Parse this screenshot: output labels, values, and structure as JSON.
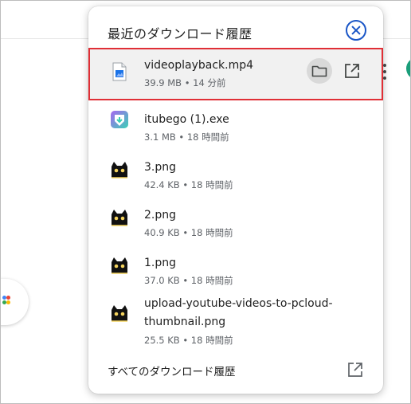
{
  "panel": {
    "title": "最近のダウンロード履歴",
    "close_icon": "close-circle-icon",
    "footer_label": "すべてのダウンロード履歴",
    "footer_icon": "open-external-icon"
  },
  "downloads": [
    {
      "name": "videoplayback.mp4",
      "meta": "39.9 MB • 14 分前",
      "icon": "video-file-icon",
      "selected": true,
      "actions": [
        "folder-icon",
        "open-external-icon"
      ]
    },
    {
      "name": "itubego (1).exe",
      "meta": "3.1 MB • 18 時間前",
      "icon": "itubego-app-icon",
      "selected": false
    },
    {
      "name": "3.png",
      "meta": "42.4 KB • 18 時間前",
      "icon": "black-cat-icon",
      "selected": false
    },
    {
      "name": "2.png",
      "meta": "40.9 KB • 18 時間前",
      "icon": "black-cat-icon",
      "selected": false
    },
    {
      "name": "1.png",
      "meta": "37.0 KB • 18 時間前",
      "icon": "black-cat-icon",
      "selected": false
    },
    {
      "name_line1": "upload-youtube-videos-to-pcloud-",
      "name_line2": "thumbnail.png",
      "meta": "25.5 KB • 18 時間前",
      "icon": "black-cat-icon",
      "selected": false
    }
  ],
  "colors": {
    "accent": "#1a56c7",
    "highlight_border": "#e02f36",
    "selected_bg": "#f1f1f1",
    "meta_text": "#5f6368"
  }
}
